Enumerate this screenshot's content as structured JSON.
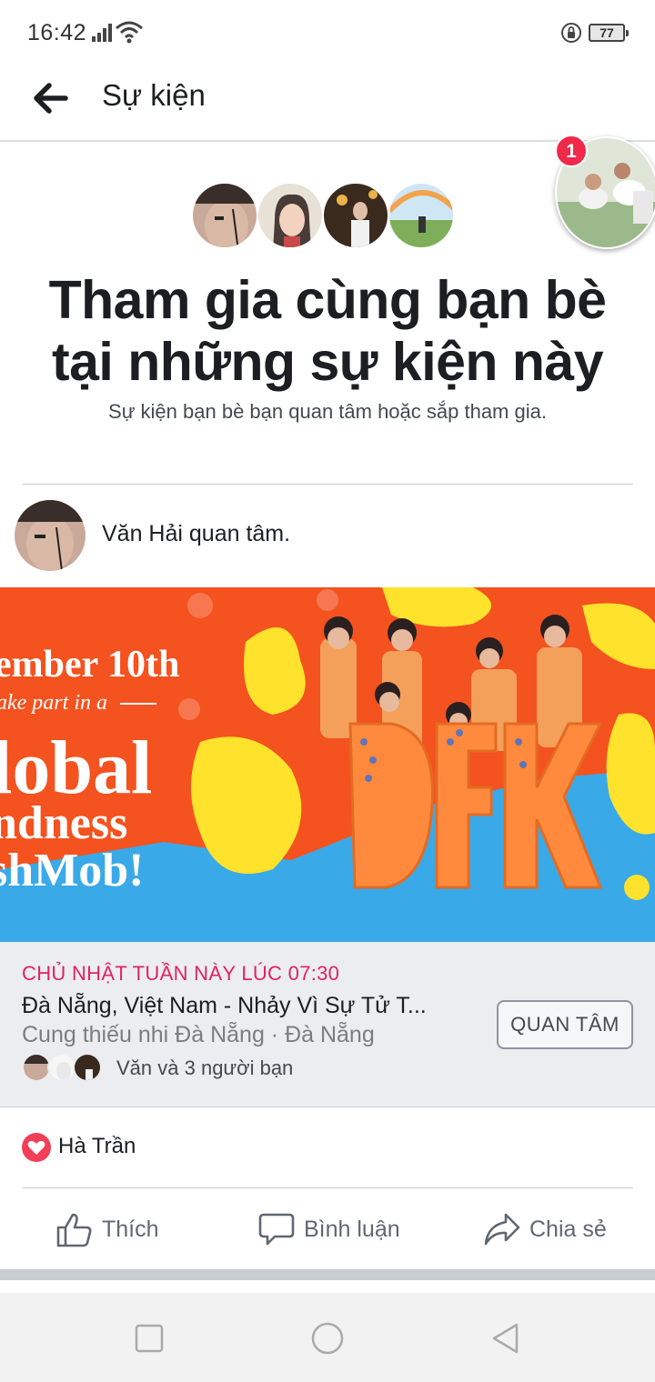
{
  "status_bar": {
    "time": "16:42",
    "battery": "77",
    "icons": [
      "signal-icon",
      "wifi-icon",
      "rotation-lock-icon",
      "battery-icon"
    ]
  },
  "header": {
    "title": "Sự kiện",
    "back_icon": "arrow-left-icon"
  },
  "chat_head": {
    "badge_count": "1"
  },
  "hero": {
    "title_line1": "Tham gia cùng bạn bè",
    "title_line2": "tại những sự kiện này",
    "subtitle": "Sự kiện bạn bè bạn quan tâm hoặc sắp tham gia."
  },
  "post": {
    "activity": "Văn Hải quan tâm.",
    "banner": {
      "line1": "ember 10th",
      "line2": "ake part in a",
      "line3": "lobal",
      "line4": "ndness",
      "line5": "shMob!",
      "letters": "DFK"
    },
    "event": {
      "date": "CHỦ NHẬT TUẦN NÀY LÚC 07:30",
      "name": "Đà Nẵng, Việt Nam - Nhảy Vì Sự Tử T...",
      "place": "Cung thiếu nhi Đà Nẵng · Đà Nẵng",
      "friends": "Văn và 3 người bạn",
      "interest_button": "QUAN TÂM"
    },
    "reaction": {
      "type": "heart-icon",
      "name": "Hà Trần"
    },
    "actions": {
      "like": "Thích",
      "comment": "Bình luận",
      "share": "Chia sẻ"
    }
  },
  "colors": {
    "event_date": "#e0245e",
    "heart": "#f33e58",
    "badge": "#f02849",
    "banner_orange": "#f4521f",
    "banner_blue": "#3aa9e8",
    "banner_yellow": "#ffe22b"
  }
}
